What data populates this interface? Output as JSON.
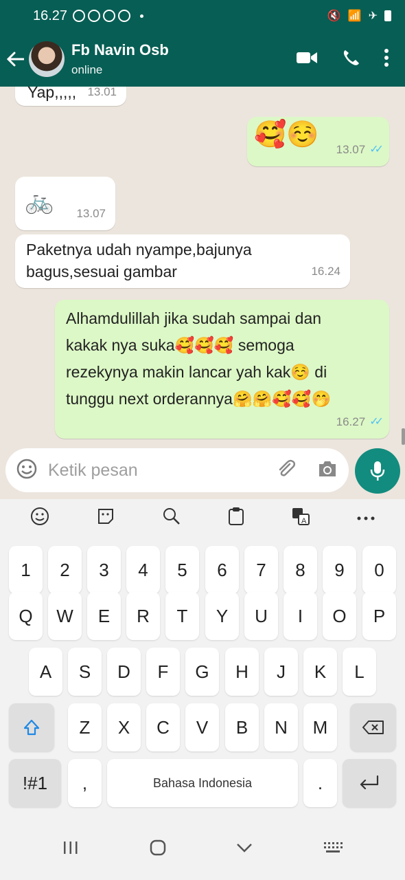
{
  "status_bar": {
    "time": "16.27"
  },
  "header": {
    "contact_name": "Fb Navin Osb",
    "status": "online"
  },
  "messages": [
    {
      "direction": "in",
      "text": "Yap,,,,,",
      "time": "13.01"
    },
    {
      "direction": "out",
      "text": "🥰☺️",
      "time": "13.07"
    },
    {
      "direction": "in",
      "text": "🚲",
      "time": "13.07"
    },
    {
      "direction": "in",
      "lines": [
        "Paketnya udah nyampe,bajunya",
        "bagus,sesuai gambar"
      ],
      "time": "16.24"
    },
    {
      "direction": "out",
      "lines": [
        "Alhamdulillah jika sudah sampai dan",
        "kakak nya suka🥰🥰🥰 semoga",
        "rezekynya makin lancar yah kak☺️ di",
        "tunggu next orderannya🤗🤗🥰🥰🤭"
      ],
      "time": "16.27"
    }
  ],
  "input": {
    "placeholder": "Ketik pesan"
  },
  "keyboard": {
    "row1": [
      "1",
      "2",
      "3",
      "4",
      "5",
      "6",
      "7",
      "8",
      "9",
      "0"
    ],
    "row2": [
      "Q",
      "W",
      "E",
      "R",
      "T",
      "Y",
      "U",
      "I",
      "O",
      "P"
    ],
    "row3": [
      "A",
      "S",
      "D",
      "F",
      "G",
      "H",
      "J",
      "K",
      "L"
    ],
    "row4": [
      "Z",
      "X",
      "C",
      "V",
      "B",
      "N",
      "M"
    ],
    "symbols": "!#1",
    "comma": ",",
    "space": "Bahasa Indonesia",
    "period": "."
  },
  "colors": {
    "header": "#075e54",
    "outgoing": "#dcf8c6",
    "incoming": "#ffffff",
    "mic": "#128c7e"
  }
}
